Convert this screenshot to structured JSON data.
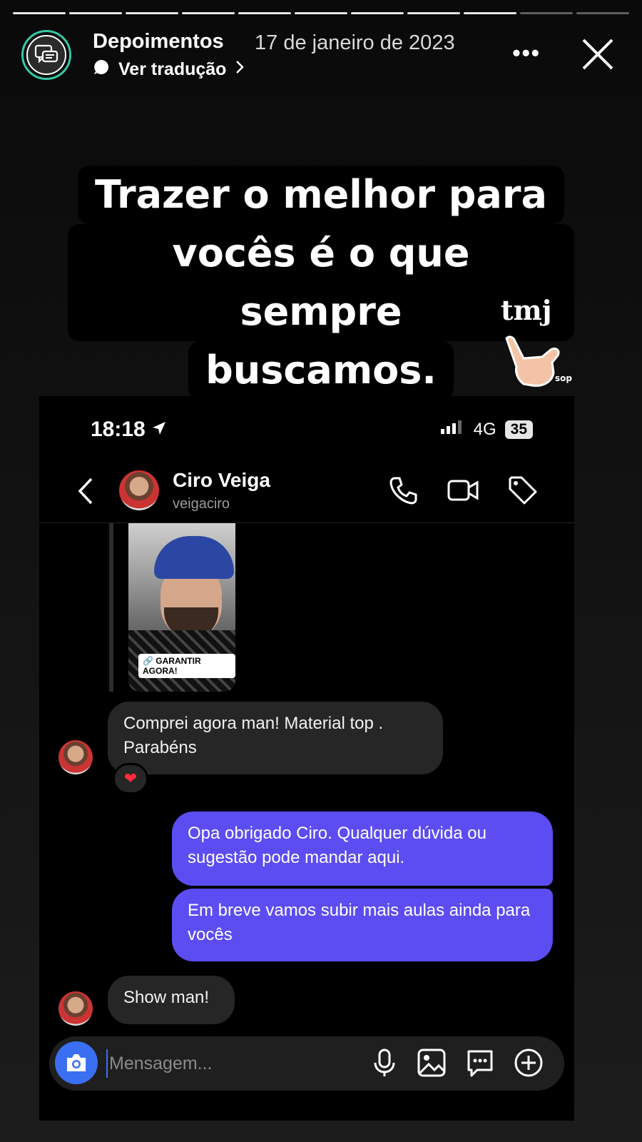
{
  "story": {
    "account": "Depoimentos",
    "date": "17 de janeiro de 2023",
    "translate_label": "Ver tradução",
    "progress_segments": 11,
    "progress_current": 10
  },
  "caption": {
    "lines": [
      "Trazer o melhor para",
      "vocês é o que sempre",
      "buscamos."
    ],
    "sticker_text": "tmj"
  },
  "phone": {
    "status": {
      "time": "18:18",
      "network": "4G",
      "battery": "35"
    },
    "chat": {
      "name": "Ciro Veiga",
      "handle": "veigaciro"
    },
    "shared_story_cta": "GARANTIR AGORA!",
    "messages": [
      {
        "from": "them",
        "text": "Comprei agora man! Material top . Parabéns",
        "reaction": "❤"
      },
      {
        "from": "me",
        "text": "Opa obrigado Ciro. Qualquer dúvida ou sugestão pode mandar aqui."
      },
      {
        "from": "me",
        "text": "Em breve vamos subir mais aulas ainda para vocês"
      },
      {
        "from": "them",
        "text": "Show man!"
      }
    ],
    "composer": {
      "placeholder": "Mensagem..."
    }
  },
  "colors": {
    "outgoing_bubble": "#5b4df2",
    "incoming_bubble": "#262626",
    "avatar_ring": "#36c8a5"
  }
}
